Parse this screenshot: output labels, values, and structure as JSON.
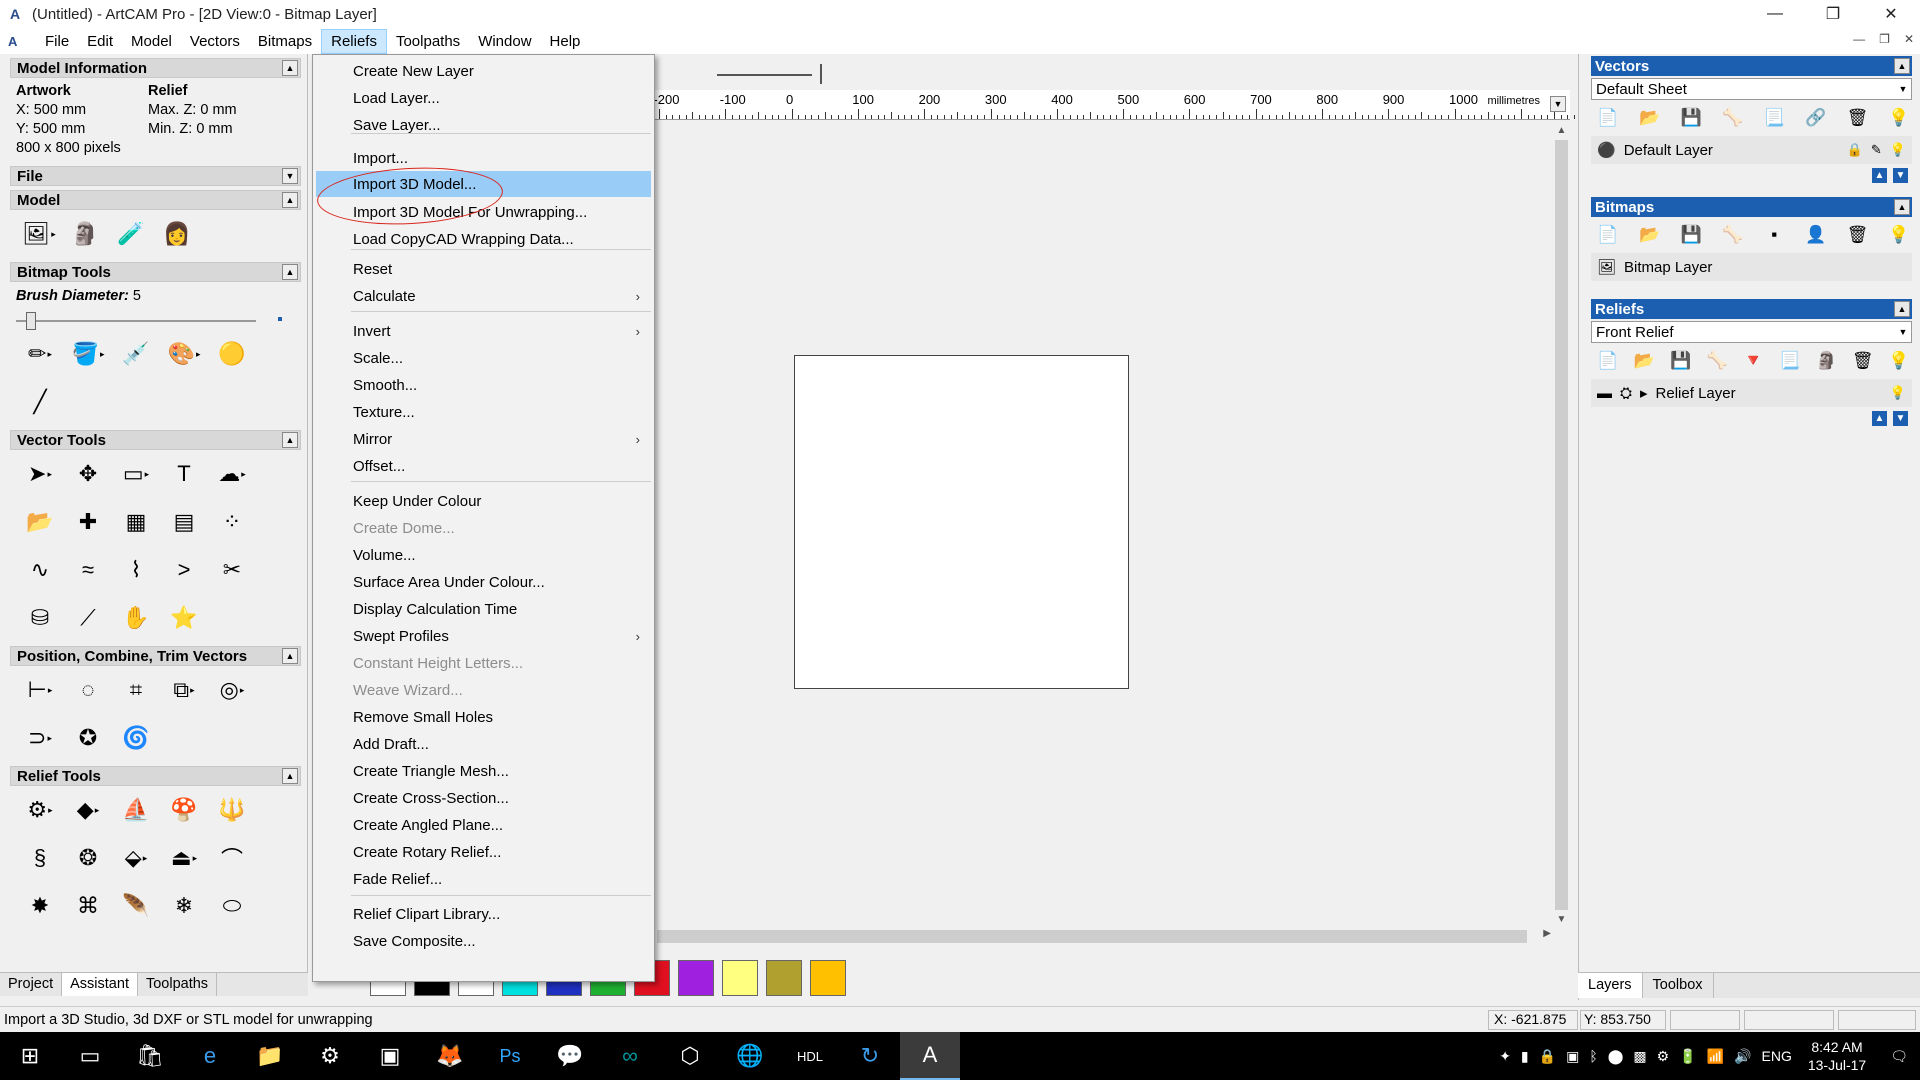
{
  "window": {
    "title": "(Untitled) - ArtCAM Pro - [2D View:0 - Bitmap Layer]",
    "minimize": "—",
    "maximize": "❐",
    "close": "✕"
  },
  "menubar": {
    "items": [
      "File",
      "Edit",
      "Model",
      "Vectors",
      "Bitmaps",
      "Reliefs",
      "Toolpaths",
      "Window",
      "Help"
    ],
    "active": "Reliefs"
  },
  "left_panel": {
    "model_information": {
      "header": "Model Information",
      "artwork_label": "Artwork",
      "relief_label": "Relief",
      "x": "X: 500 mm",
      "y": "Y: 500 mm",
      "pixels": "800 x 800 pixels",
      "max_z": "Max. Z: 0 mm",
      "min_z": "Min. Z: 0 mm"
    },
    "sections": {
      "file": "File",
      "model": "Model",
      "bitmap_tools": "Bitmap Tools",
      "vector_tools": "Vector Tools",
      "position_combine": "Position, Combine, Trim Vectors",
      "relief_tools": "Relief Tools"
    },
    "brush_label": "Brush Diameter:",
    "brush_value": "5",
    "tabs": [
      "Project",
      "Assistant",
      "Toolpaths"
    ],
    "active_tab": "Assistant"
  },
  "ruler": {
    "ticks": [
      "-200",
      "-100",
      "0",
      "100",
      "200",
      "300",
      "400",
      "500",
      "600",
      "700",
      "800",
      "900",
      "1000"
    ],
    "unit": "millimetres"
  },
  "reliefs_menu": {
    "items": [
      {
        "label": "Create New Layer",
        "enabled": true
      },
      {
        "label": "Load Layer...",
        "enabled": true
      },
      {
        "label": "Save Layer...",
        "enabled": true
      },
      {
        "label": "Import...",
        "enabled": true
      },
      {
        "label": "Import 3D Model...",
        "enabled": true,
        "highlighted": true
      },
      {
        "label": "Import 3D Model For Unwrapping...",
        "enabled": true
      },
      {
        "label": "Load CopyCAD Wrapping Data...",
        "enabled": true
      },
      {
        "label": "Reset",
        "enabled": true
      },
      {
        "label": "Calculate",
        "enabled": true,
        "submenu": true
      },
      {
        "label": "Invert",
        "enabled": true,
        "submenu": true
      },
      {
        "label": "Scale...",
        "enabled": true
      },
      {
        "label": "Smooth...",
        "enabled": true
      },
      {
        "label": "Texture...",
        "enabled": true
      },
      {
        "label": "Mirror",
        "enabled": true,
        "submenu": true
      },
      {
        "label": "Offset...",
        "enabled": true
      },
      {
        "label": "Keep Under Colour",
        "enabled": true
      },
      {
        "label": "Create Dome...",
        "enabled": false
      },
      {
        "label": "Volume...",
        "enabled": true
      },
      {
        "label": "Surface Area Under Colour...",
        "enabled": true
      },
      {
        "label": "Display Calculation Time",
        "enabled": true
      },
      {
        "label": "Swept Profiles",
        "enabled": true,
        "submenu": true
      },
      {
        "label": "Constant Height Letters...",
        "enabled": false
      },
      {
        "label": "Weave Wizard...",
        "enabled": false
      },
      {
        "label": "Remove Small Holes",
        "enabled": true
      },
      {
        "label": "Add Draft...",
        "enabled": true
      },
      {
        "label": "Create Triangle Mesh...",
        "enabled": true
      },
      {
        "label": "Create Cross-Section...",
        "enabled": true
      },
      {
        "label": "Create Angled Plane...",
        "enabled": true
      },
      {
        "label": "Create Rotary Relief...",
        "enabled": true
      },
      {
        "label": "Fade Relief...",
        "enabled": true
      },
      {
        "label": "Relief Clipart Library...",
        "enabled": true
      },
      {
        "label": "Save Composite...",
        "enabled": true
      }
    ]
  },
  "palette": {
    "colors": [
      "#ffffff",
      "#000000",
      "#ffffff",
      "#00e0e0",
      "#2030c0",
      "#20b030",
      "#e01020",
      "#a020e0",
      "#ffff80",
      "#b0a030",
      "#ffc000"
    ]
  },
  "right_panel": {
    "vectors": {
      "header": "Vectors",
      "sheet": "Default Sheet",
      "layer": "Default Layer"
    },
    "bitmaps": {
      "header": "Bitmaps",
      "layer": "Bitmap Layer"
    },
    "reliefs": {
      "header": "Reliefs",
      "relief": "Front Relief",
      "layer": "Relief Layer"
    },
    "tabs": [
      "Layers",
      "Toolbox"
    ],
    "active_tab": "Layers"
  },
  "status_bar": {
    "message": "Import a 3D Studio, 3d DXF or STL model for unwrapping",
    "x": "X: -621.875",
    "y": "Y: 853.750"
  },
  "taskbar": {
    "language": "ENG",
    "time": "8:42 AM",
    "date": "13-Jul-17"
  }
}
